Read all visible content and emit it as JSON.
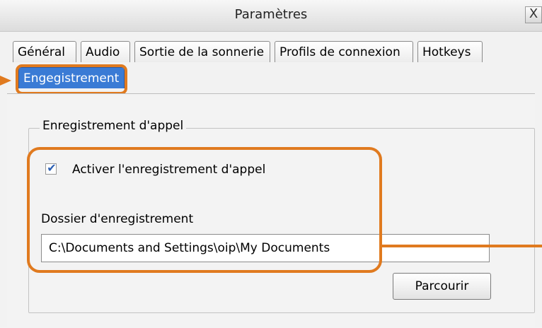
{
  "window": {
    "title": "Paramètres",
    "close_label": "X"
  },
  "tabs": [
    {
      "label": "Général"
    },
    {
      "label": "Audio"
    },
    {
      "label": "Sortie de la sonnerie"
    },
    {
      "label": "Profils de connexion"
    },
    {
      "label": "Hotkeys"
    },
    {
      "label": "Engegistrement",
      "active": true
    }
  ],
  "recording": {
    "group_title": "Enregistrement d'appel",
    "enable_label": "Activer l'enregistrement d'appel",
    "enable_checked": true,
    "folder_label": "Dossier d'enregistrement",
    "folder_value": "C:\\Documents and Settings\\oip\\My Documents",
    "browse_label": "Parcourir"
  },
  "colors": {
    "highlight": "#e07a1f",
    "active_tab": "#3a7bd5"
  }
}
